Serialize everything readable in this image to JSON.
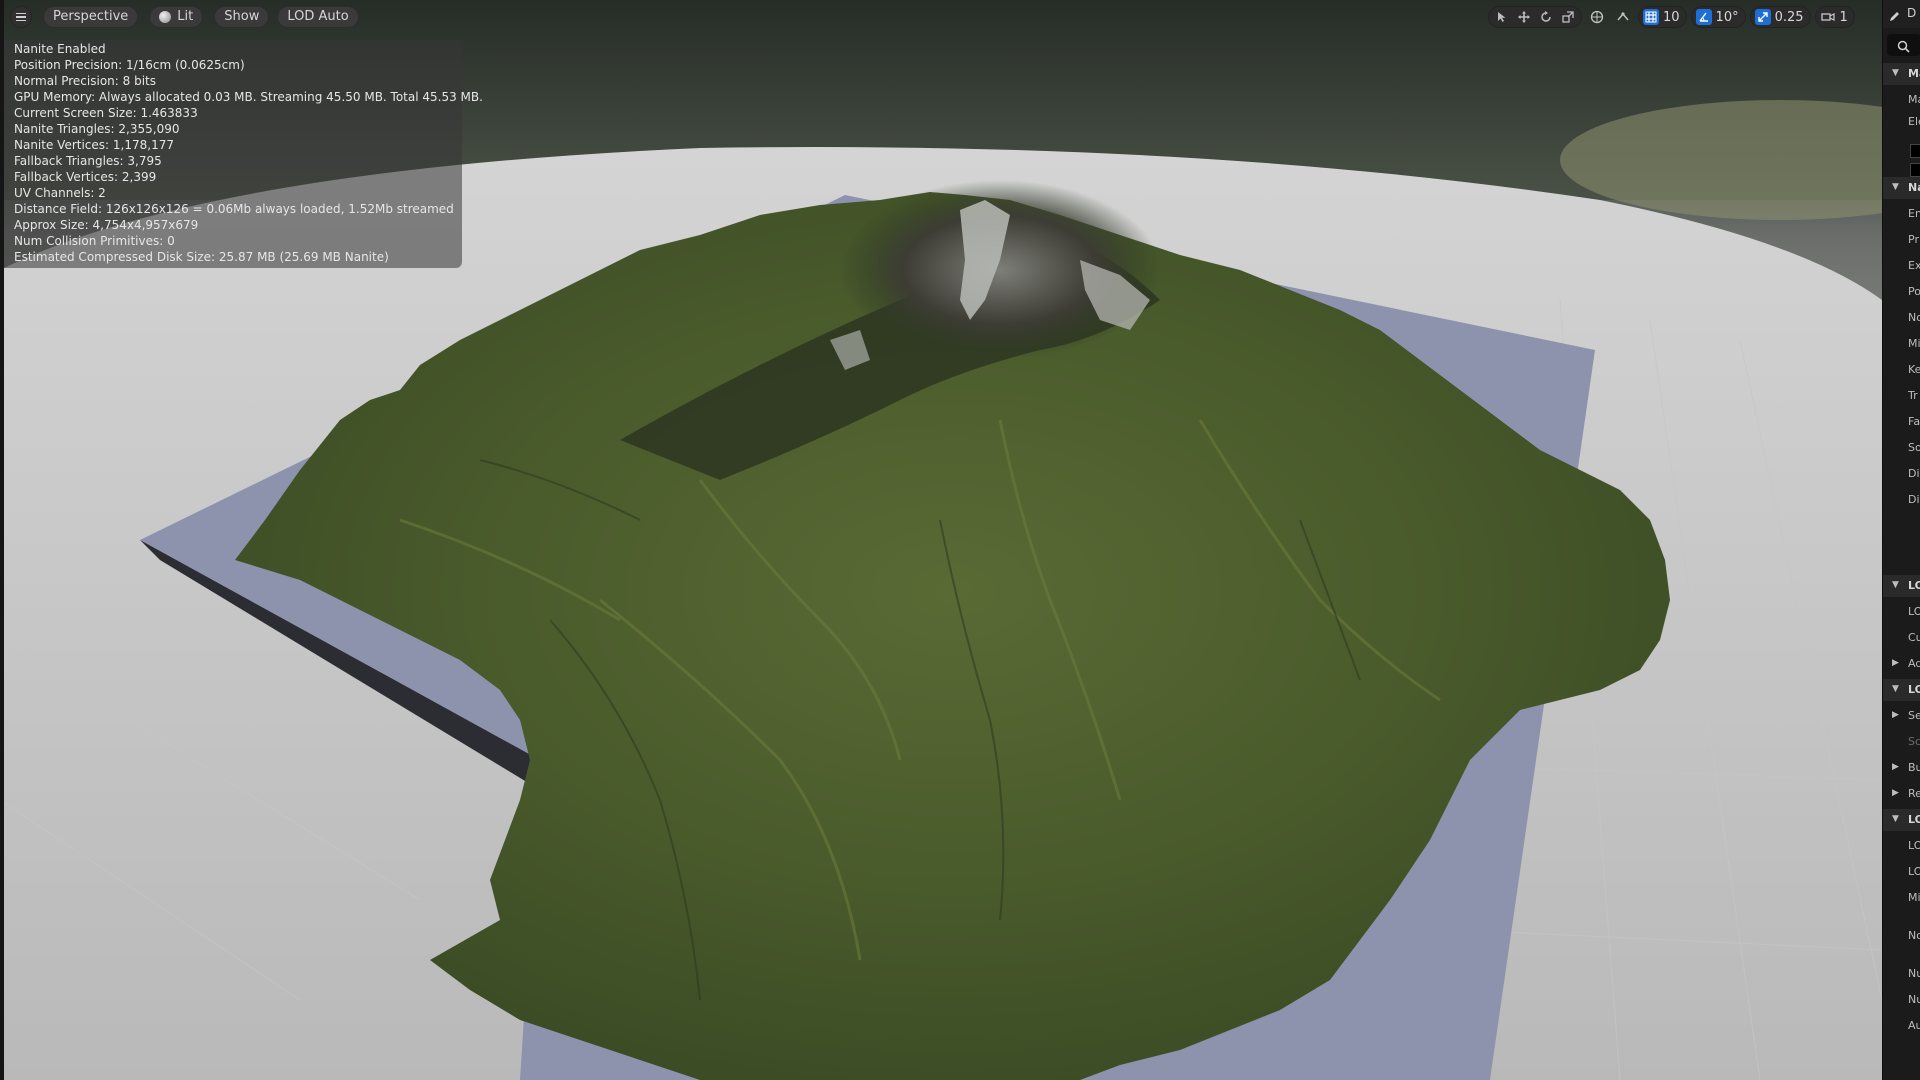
{
  "toolbar": {
    "view_mode": "Perspective",
    "lighting": "Lit",
    "show": "Show",
    "lod": "LOD Auto",
    "grid_snap_value": "10",
    "rotation_snap_value": "10°",
    "scale_snap_value": "0.25",
    "camera_speed_value": "1",
    "accent_color": "#1d6fd6"
  },
  "stats": {
    "lines": [
      "Nanite Enabled",
      "Position Precision: 1/16cm (0.0625cm)",
      "Normal Precision: 8 bits",
      "GPU Memory: Always allocated 0.03 MB. Streaming 45.50 MB. Total 45.53 MB.",
      "Current Screen Size:  1.463833",
      "Nanite Triangles:  2,355,090",
      "Nanite Vertices:  1,178,177",
      "Fallback Triangles:  3,795",
      "Fallback Vertices:  2,399",
      "UV Channels:  2",
      "Distance Field:  126x126x126 = 0.06Mb always loaded, 1.52Mb streamed",
      "Approx Size: 4,754x4,957x679",
      "Num Collision Primitives:  0",
      "Estimated Compressed Disk Size: 25.87 MB (25.69 MB Nanite)"
    ]
  },
  "panel": {
    "header_fragment": "D",
    "rows": [
      {
        "label": "Ma",
        "type": "category"
      },
      {
        "label": "Ma",
        "type": "prop"
      },
      {
        "label": "Ele",
        "type": "prop"
      },
      {
        "label": "Na",
        "type": "category"
      },
      {
        "label": "En",
        "type": "prop"
      },
      {
        "label": "Pr",
        "type": "prop"
      },
      {
        "label": "Ex",
        "type": "prop"
      },
      {
        "label": "Po",
        "type": "prop"
      },
      {
        "label": "No",
        "type": "prop"
      },
      {
        "label": "Mi",
        "type": "prop"
      },
      {
        "label": "Ke",
        "type": "prop"
      },
      {
        "label": "Tr",
        "type": "prop"
      },
      {
        "label": "Fa",
        "type": "prop"
      },
      {
        "label": "So",
        "type": "prop"
      },
      {
        "label": "Dis",
        "type": "prop"
      },
      {
        "label": "Dis",
        "type": "prop"
      },
      {
        "label": "LO",
        "type": "category"
      },
      {
        "label": "LO",
        "type": "prop"
      },
      {
        "label": "Cu",
        "type": "prop"
      },
      {
        "label": "Ad",
        "type": "collapsed"
      },
      {
        "label": "LO",
        "type": "category"
      },
      {
        "label": "Se",
        "type": "collapsed"
      },
      {
        "label": "Sc",
        "type": "dim"
      },
      {
        "label": "Bu",
        "type": "collapsed"
      },
      {
        "label": "Re",
        "type": "collapsed"
      },
      {
        "label": "LO",
        "type": "category"
      },
      {
        "label": "LO",
        "type": "prop"
      },
      {
        "label": "LO",
        "type": "prop"
      },
      {
        "label": "Mi",
        "type": "prop"
      },
      {
        "label": "No",
        "type": "prop"
      },
      {
        "label": "Nu",
        "type": "prop"
      },
      {
        "label": "Nu",
        "type": "prop"
      },
      {
        "label": "Au",
        "type": "prop"
      }
    ]
  }
}
